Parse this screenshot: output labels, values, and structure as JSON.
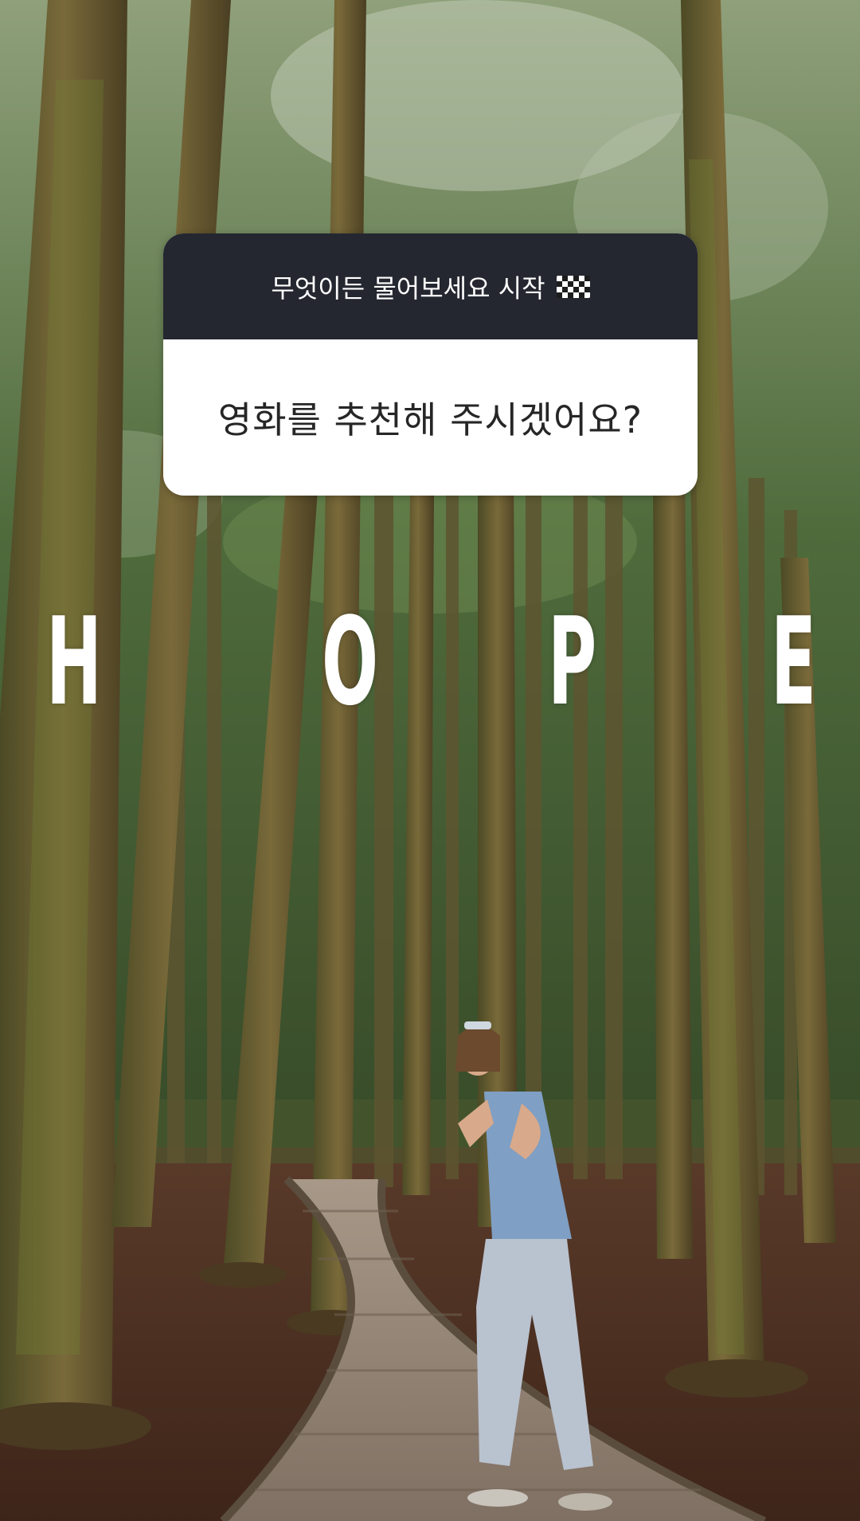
{
  "question_sticker": {
    "header": "무엇이든 물어보세요 시작",
    "header_icon": "checkered-flag-icon",
    "question": "영화를 추천해 주시겠어요?"
  },
  "overlay_text": {
    "letters": [
      "H",
      "O",
      "P",
      "E"
    ]
  },
  "colors": {
    "sticker_header_bg": "#242730",
    "sticker_body_bg": "#ffffff",
    "overlay_text": "#ffffff"
  }
}
